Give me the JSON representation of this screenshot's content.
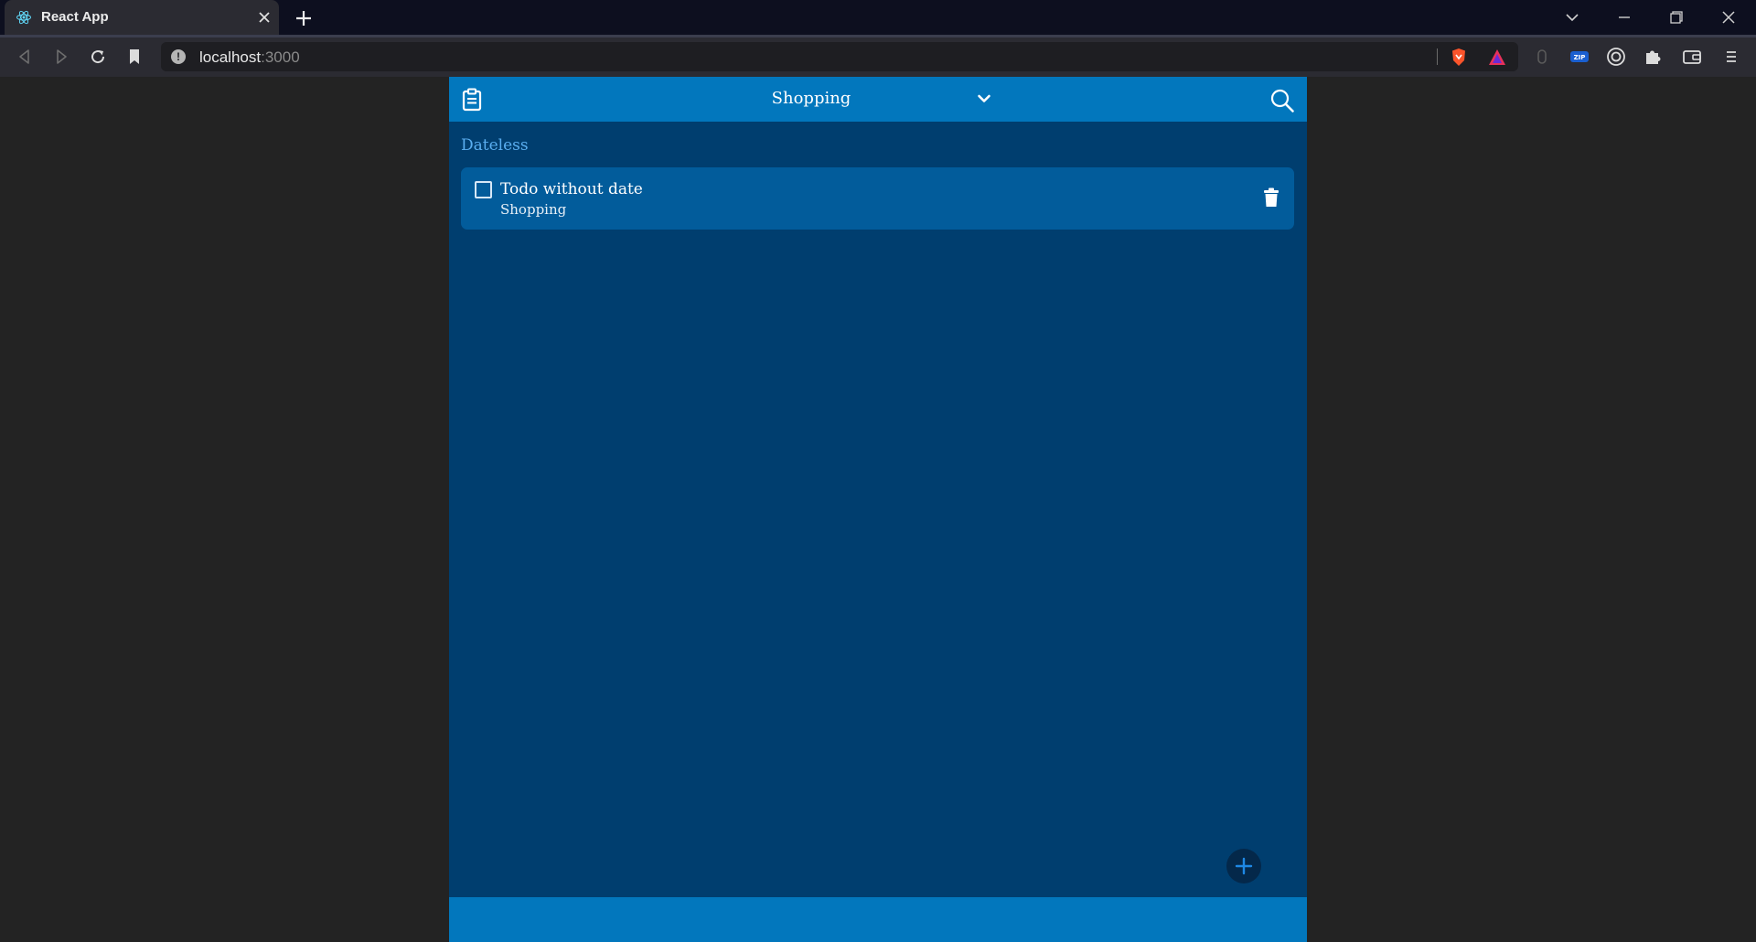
{
  "browser": {
    "tab": {
      "title": "React App",
      "favicon": "react-icon"
    },
    "url": {
      "host": "localhost",
      "port": ":3000"
    },
    "icons": [
      "back-icon",
      "forward-icon",
      "reload-icon",
      "bookmark-icon",
      "brave-shield-icon",
      "brave-rewards-icon",
      "extension-icon",
      "zip-extension-icon",
      "target-extension-icon",
      "puzzle-icon",
      "wallet-icon",
      "menu-icon"
    ]
  },
  "app": {
    "header": {
      "title": "Shopping",
      "icons": [
        "clipboard-icon",
        "chevron-down-icon",
        "search-icon"
      ]
    },
    "section_label": "Dateless",
    "todos": [
      {
        "title": "Todo without date",
        "list": "Shopping",
        "checked": false
      }
    ],
    "colors": {
      "header": "#0277bd",
      "background": "#003e6f",
      "card": "#025c9b",
      "section_label": "#5aaef0",
      "fab": "#04284a",
      "fab_icon": "#1e88e5"
    }
  }
}
